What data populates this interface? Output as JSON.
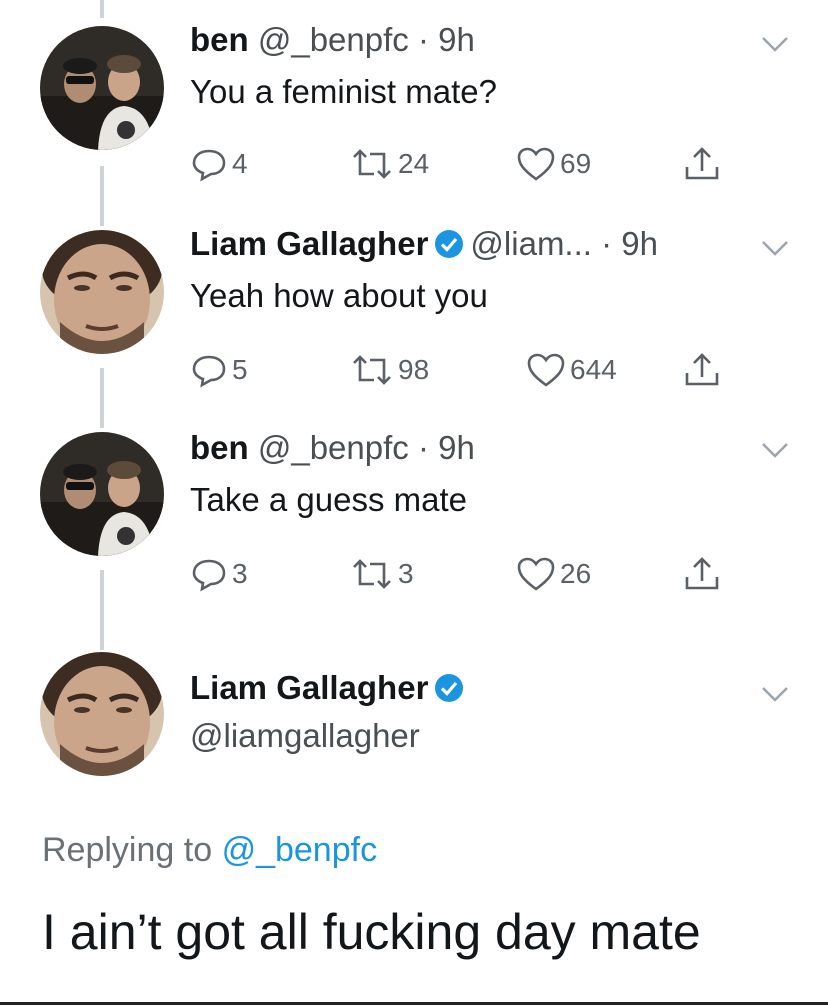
{
  "accent_color": "#1b95e0",
  "tweets": [
    {
      "name": "ben",
      "handle_time": "@_benpfc · 9h",
      "verified": false,
      "text": "You a feminist mate?",
      "replies": "4",
      "retweets": "24",
      "likes": "69"
    },
    {
      "name": "Liam Gallagher",
      "handle_time": "@liam... · 9h",
      "verified": true,
      "text": "Yeah how about you",
      "replies": "5",
      "retweets": "98",
      "likes": "644"
    },
    {
      "name": "ben",
      "handle_time": "@_benpfc · 9h",
      "verified": false,
      "text": "Take a guess mate",
      "replies": "3",
      "retweets": "3",
      "likes": "26"
    }
  ],
  "focused": {
    "name": "Liam Gallagher",
    "handle": "@liamgallagher",
    "verified": true,
    "replying_label": "Replying to",
    "replying_to": "@_benpfc",
    "text": "I ain’t got all fucking day mate"
  }
}
